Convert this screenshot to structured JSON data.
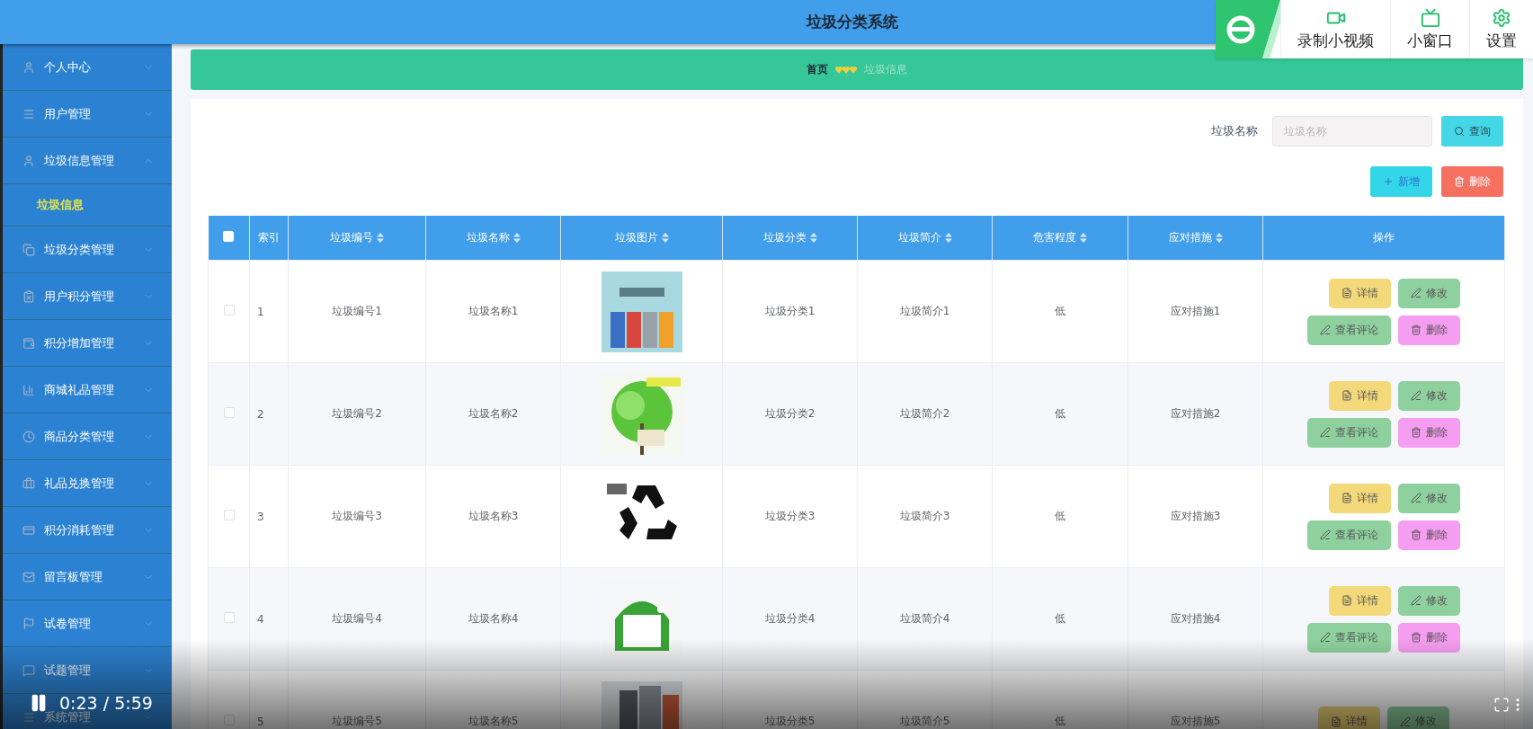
{
  "header": {
    "title": "垃圾分类系统"
  },
  "player_toolbar": {
    "items": [
      {
        "label": "录制小视频",
        "kind": "record"
      },
      {
        "label": "小窗口",
        "kind": "mini"
      },
      {
        "label": "设置",
        "kind": "settings"
      }
    ]
  },
  "sidebar": {
    "items": [
      {
        "label": "个人中心",
        "expanded": false
      },
      {
        "label": "用户管理",
        "expanded": false
      },
      {
        "label": "垃圾信息管理",
        "expanded": true,
        "children": [
          {
            "label": "垃圾信息",
            "selected": true
          }
        ]
      },
      {
        "label": "垃圾分类管理",
        "expanded": false
      },
      {
        "label": "用户积分管理",
        "expanded": false
      },
      {
        "label": "积分增加管理",
        "expanded": false
      },
      {
        "label": "商城礼品管理",
        "expanded": false
      },
      {
        "label": "商品分类管理",
        "expanded": false
      },
      {
        "label": "礼品兑换管理",
        "expanded": false
      },
      {
        "label": "积分消耗管理",
        "expanded": false
      },
      {
        "label": "留言板管理",
        "expanded": false
      },
      {
        "label": "试卷管理",
        "expanded": false
      },
      {
        "label": "试题管理",
        "expanded": false
      },
      {
        "label": "系统管理",
        "expanded": false
      }
    ]
  },
  "breadcrumb": [
    {
      "label": "首页",
      "selected": false
    },
    {
      "label": "垃圾信息",
      "selected": true
    }
  ],
  "search": {
    "label": "垃圾名称",
    "placeholder": "垃圾名称",
    "button": "查询"
  },
  "actions": [
    {
      "label": "新增",
      "kind": "add"
    },
    {
      "label": "删除",
      "kind": "delete"
    }
  ],
  "table": {
    "select_all": {
      "checked": false
    },
    "columns": [
      {
        "label": "索引",
        "sortable": false
      },
      {
        "label": "垃圾编号",
        "sortable": true
      },
      {
        "label": "垃圾名称",
        "sortable": true
      },
      {
        "label": "垃圾图片",
        "sortable": true
      },
      {
        "label": "垃圾分类",
        "sortable": true
      },
      {
        "label": "垃圾简介",
        "sortable": true
      },
      {
        "label": "危害程度",
        "sortable": true
      },
      {
        "label": "应对措施",
        "sortable": true
      },
      {
        "label": "操作",
        "sortable": false
      }
    ],
    "rows": [
      {
        "checked": false,
        "cells": [
          "1",
          "垃圾编号1",
          "垃圾名称1"
        ],
        "image": {
          "kind": "picture"
        },
        "cells_after": [
          "垃圾分类1",
          "垃圾简介1",
          "低",
          "应对措施1"
        ],
        "actions": [
          {
            "label": "详情",
            "kind": "detail"
          },
          {
            "label": "修改",
            "kind": "edit"
          },
          {
            "label": "查看评论",
            "kind": "comments"
          },
          {
            "label": "删除",
            "kind": "delete"
          }
        ]
      },
      {
        "checked": false,
        "cells": [
          "2",
          "垃圾编号2",
          "垃圾名称2"
        ],
        "image": {
          "kind": "picture"
        },
        "cells_after": [
          "垃圾分类2",
          "垃圾简介2",
          "低",
          "应对措施2"
        ],
        "actions": [
          {
            "label": "详情",
            "kind": "detail"
          },
          {
            "label": "修改",
            "kind": "edit"
          },
          {
            "label": "查看评论",
            "kind": "comments"
          },
          {
            "label": "删除",
            "kind": "delete"
          }
        ]
      },
      {
        "checked": false,
        "cells": [
          "3",
          "垃圾编号3",
          "垃圾名称3"
        ],
        "image": {
          "kind": "picture"
        },
        "cells_after": [
          "垃圾分类3",
          "垃圾简介3",
          "低",
          "应对措施3"
        ],
        "actions": [
          {
            "label": "详情",
            "kind": "detail"
          },
          {
            "label": "修改",
            "kind": "edit"
          },
          {
            "label": "查看评论",
            "kind": "comments"
          },
          {
            "label": "删除",
            "kind": "delete"
          }
        ]
      },
      {
        "checked": false,
        "cells": [
          "4",
          "垃圾编号4",
          "垃圾名称4"
        ],
        "image": {
          "kind": "picture"
        },
        "cells_after": [
          "垃圾分类4",
          "垃圾简介4",
          "低",
          "应对措施4"
        ],
        "actions": [
          {
            "label": "详情",
            "kind": "detail"
          },
          {
            "label": "修改",
            "kind": "edit"
          },
          {
            "label": "查看评论",
            "kind": "comments"
          },
          {
            "label": "删除",
            "kind": "delete"
          }
        ]
      },
      {
        "checked": false,
        "cells": [
          "5",
          "垃圾编号5",
          "垃圾名称5"
        ],
        "image": {
          "kind": "picture"
        },
        "cells_after": [
          "垃圾分类5",
          "垃圾简介5",
          "低",
          "应对措施5"
        ],
        "actions": [
          {
            "label": "详情",
            "kind": "detail"
          },
          {
            "label": "修改",
            "kind": "edit"
          }
        ]
      }
    ]
  },
  "player": {
    "time": "0:23 / 5:59"
  }
}
